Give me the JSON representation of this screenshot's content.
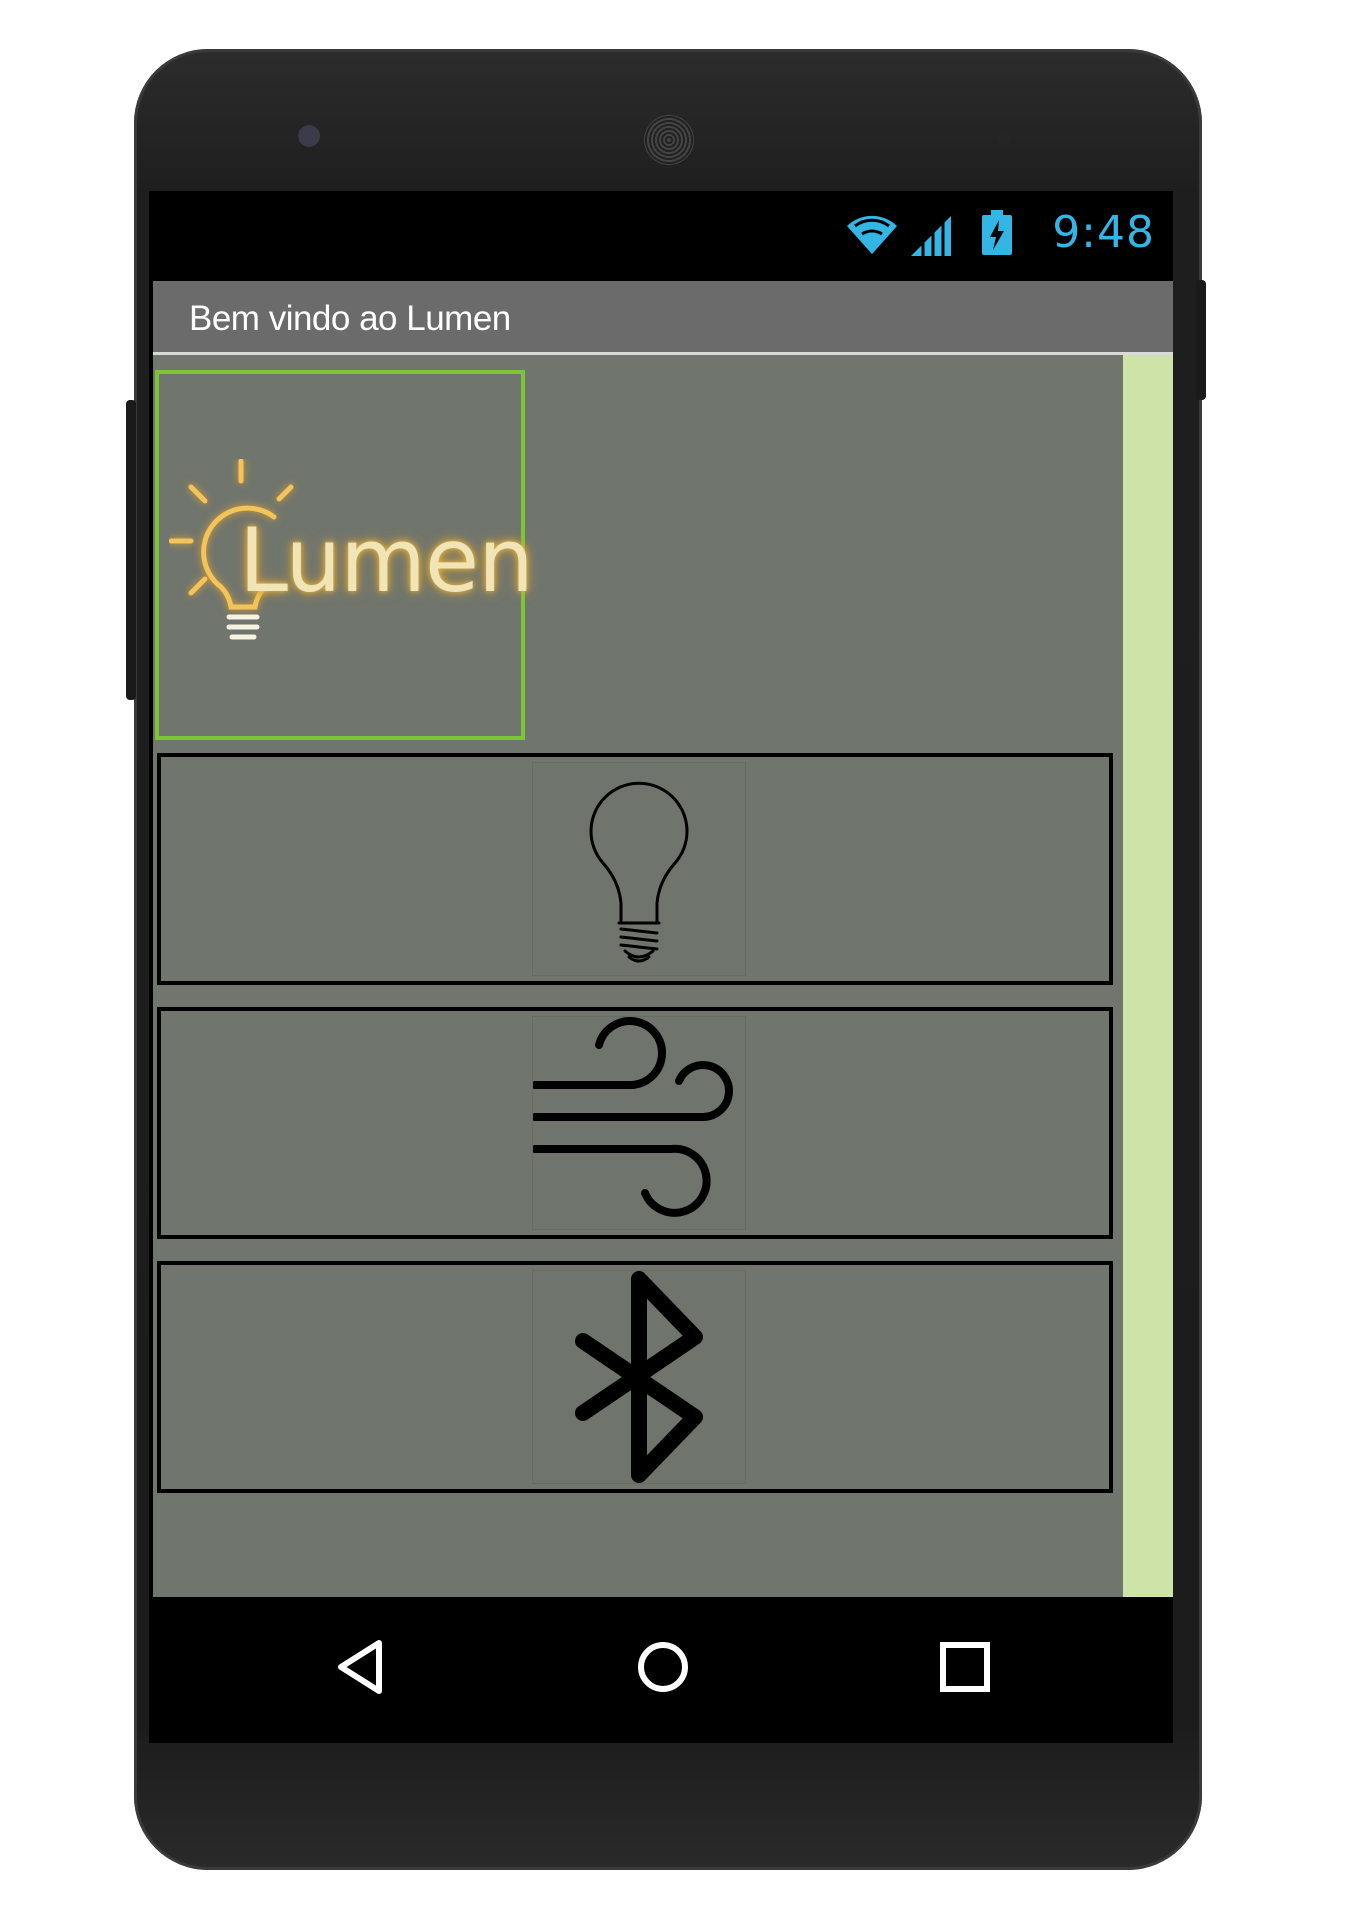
{
  "status_bar": {
    "time": "9:48",
    "icons": [
      "wifi-icon",
      "cellular-signal-icon",
      "battery-charging-icon"
    ],
    "accent_color": "#33b5e5"
  },
  "app_bar": {
    "title": "Bem vindo ao Lumen",
    "background": "#6b6b6b"
  },
  "logo": {
    "text": "Lumen",
    "icon": "lightbulb-glow-icon",
    "border_color": "#7dc536"
  },
  "buttons": [
    {
      "name": "light-button",
      "icon": "lightbulb-icon"
    },
    {
      "name": "fan-button",
      "icon": "wind-icon"
    },
    {
      "name": "bluetooth-button",
      "icon": "bluetooth-icon"
    }
  ],
  "nav_bar": {
    "items": [
      "back-icon",
      "home-icon",
      "recents-icon"
    ]
  },
  "colors": {
    "content_background": "#70756d",
    "scroll_rail": "#cde3a8"
  }
}
